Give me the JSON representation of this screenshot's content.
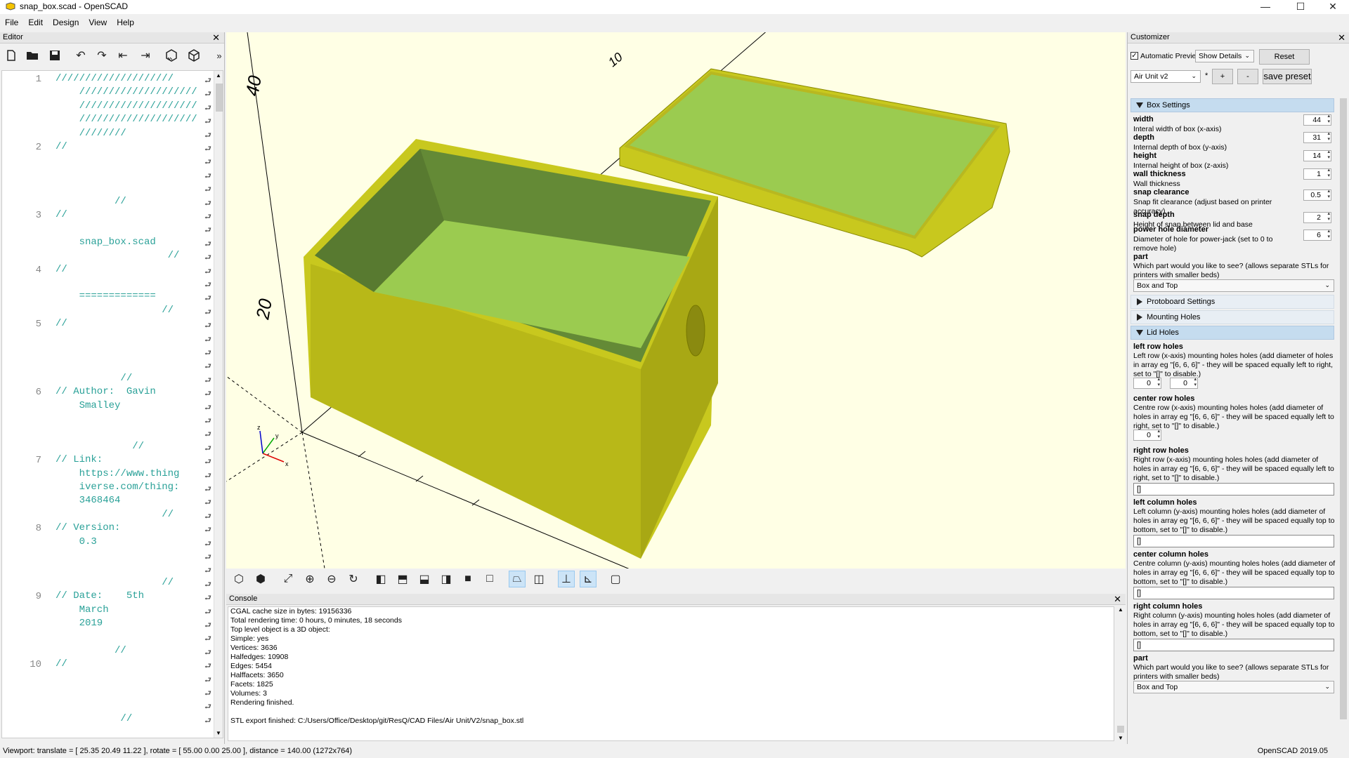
{
  "window": {
    "title": "snap_box.scad - OpenSCAD",
    "minimize": "—",
    "maximize": "☐",
    "close": "✕"
  },
  "menu": [
    "File",
    "Edit",
    "Design",
    "View",
    "Help"
  ],
  "editor": {
    "title": "Editor",
    "toolbar_icons": [
      "new-file-icon",
      "open-file-icon",
      "save-icon",
      "undo-icon",
      "redo-icon",
      "unindent-icon",
      "indent-icon",
      "preview-icon",
      "render-icon",
      "more-icon"
    ],
    "more": "»",
    "lines": [
      {
        "n": "1",
        "text": [
          "////////////////////",
          "    ////////////////////",
          "    ////////////////////",
          "    ////////////////////",
          "    ////////"
        ]
      },
      {
        "n": "2",
        "text": [
          "//",
          "",
          "",
          "",
          "          //"
        ]
      },
      {
        "n": "3",
        "text": [
          "//",
          "",
          "    snap_box.scad",
          "                   //"
        ]
      },
      {
        "n": "4",
        "text": [
          "//",
          "",
          "    =============",
          "                  //"
        ]
      },
      {
        "n": "5",
        "text": [
          "//",
          "",
          "",
          "",
          "           //"
        ]
      },
      {
        "n": "6",
        "text": [
          "// Author:  Gavin",
          "    Smalley",
          "",
          "",
          "             //"
        ]
      },
      {
        "n": "7",
        "text": [
          "// Link:",
          "    https://www.thing",
          "    iverse.com/thing:",
          "    3468464",
          "                  //"
        ]
      },
      {
        "n": "8",
        "text": [
          "// Version:",
          "    0.3",
          "",
          "",
          "                  //"
        ]
      },
      {
        "n": "9",
        "text": [
          "// Date:    5th",
          "    March",
          "    2019",
          "",
          "          //"
        ]
      },
      {
        "n": "10",
        "text": [
          "//",
          "",
          "",
          "",
          "           //"
        ]
      }
    ]
  },
  "viewport": {
    "axis_labels": [
      "10",
      "20",
      "40"
    ],
    "colors": {
      "box_outer": "#c8c81e",
      "box_inner": "#9bcb50",
      "background": "#ffffe5"
    }
  },
  "view_toolbar_icons": [
    "preview-icon",
    "render-icon",
    "view-all-icon",
    "zoom-in-icon",
    "zoom-out-icon",
    "reset-view-icon",
    "view-right-icon",
    "view-top-icon",
    "view-bottom-icon",
    "view-left-icon",
    "view-front-icon",
    "view-back-icon",
    "perspective-icon",
    "orthogonal-icon",
    "show-axes-icon",
    "show-scale-markers-icon",
    "show-edges-icon"
  ],
  "console": {
    "title": "Console",
    "lines": [
      "CGAL cache size in bytes: 19156336",
      "Total rendering time: 0 hours, 0 minutes, 18 seconds",
      "Top level object is a 3D object:",
      "Simple: yes",
      "Vertices: 3636",
      "Halfedges: 10908",
      "Edges: 5454",
      "Halffacets: 3650",
      "Facets: 1825",
      "Volumes: 3",
      "Rendering finished.",
      "",
      "STL export finished: C:/Users/Office/Desktop/git/ResQ/CAD Files/Air Unit/V2/snap_box.stl"
    ]
  },
  "customizer": {
    "title": "Customizer",
    "auto_preview": "Automatic Preview",
    "details": "Show Details",
    "reset": "Reset",
    "preset": "Air Unit v2",
    "preset_mod": "*",
    "plus": "+",
    "minus": "-",
    "save_preset": "save preset",
    "box_settings": "Box Settings",
    "params": [
      {
        "name": "width",
        "desc": "Interal width of box (x-axis)",
        "value": "44"
      },
      {
        "name": "depth",
        "desc": "Internal depth of box (y-axis)",
        "value": "31"
      },
      {
        "name": "height",
        "desc": "Internal height of box (z-axis)",
        "value": "14"
      },
      {
        "name": "wall thickness",
        "desc": "Wall thickness",
        "value": "1"
      },
      {
        "name": "snap clearance",
        "desc": "Snap fit clearance (adjust based on printer accuracy)",
        "value": "0.5"
      },
      {
        "name": "snap depth",
        "desc": "Height of snap between lid and base",
        "value": "2"
      },
      {
        "name": "power hole diameter",
        "desc": "Diameter of hole for power-jack (set to 0 to remove hole)",
        "value": "6"
      }
    ],
    "part1": {
      "name": "part",
      "desc": "Which part would you like to see? (allows separate STLs for printers with smaller beds)",
      "value": "Box and Top"
    },
    "protoboard": "Protoboard Settings",
    "mounting": "Mounting Holes",
    "lid_holes": "Lid Holes",
    "lid_params": [
      {
        "name": "left row holes",
        "desc": "Left row (x-axis) mounting holes holes (add diameter of holes in array eg \"[6, 6, 6]\" - they will be spaced equally left to right, set to \"[]\" to disable.)",
        "values": [
          "0",
          "0"
        ]
      },
      {
        "name": "center row holes",
        "desc": "Centre row (x-axis) mounting holes holes (add diameter of holes in array eg \"[6, 6, 6]\" - they will be spaced equally left to right, set to \"[]\" to disable.)",
        "values": [
          "0"
        ]
      },
      {
        "name": "right row holes",
        "desc": "Right row (x-axis) mounting holes holes (add diameter of holes in array eg \"[6, 6, 6]\" - they will be spaced equally left to right, set to \"[]\" to disable.)",
        "text": "[]"
      },
      {
        "name": "left column holes",
        "desc": "Left column (y-axis) mounting holes holes (add diameter of holes in array eg \"[6, 6, 6]\" - they will be spaced equally top to bottom, set to \"[]\" to disable.)",
        "text": "[]"
      },
      {
        "name": "center column holes",
        "desc": "Centre column (y-axis) mounting holes holes (add diameter of holes in array eg \"[6, 6, 6]\" - they will be spaced equally top to bottom, set to \"[]\" to disable.)",
        "text": "[]"
      },
      {
        "name": "right column holes",
        "desc": "Right column (y-axis) mounting holes holes (add diameter of holes in array eg \"[6, 6, 6]\" - they will be spaced equally top to bottom, set to \"[]\" to disable.)",
        "text": "[]"
      }
    ],
    "part2": {
      "name": "part",
      "desc": "Which part would you like to see? (allows separate STLs for printers with smaller beds)",
      "value": "Box and Top"
    }
  },
  "status": {
    "left": "Viewport: translate = [ 25.35 20.49 11.22 ], rotate = [ 55.00 0.00 25.00 ], distance = 140.00 (1272x764)",
    "right": "OpenSCAD 2019.05"
  }
}
